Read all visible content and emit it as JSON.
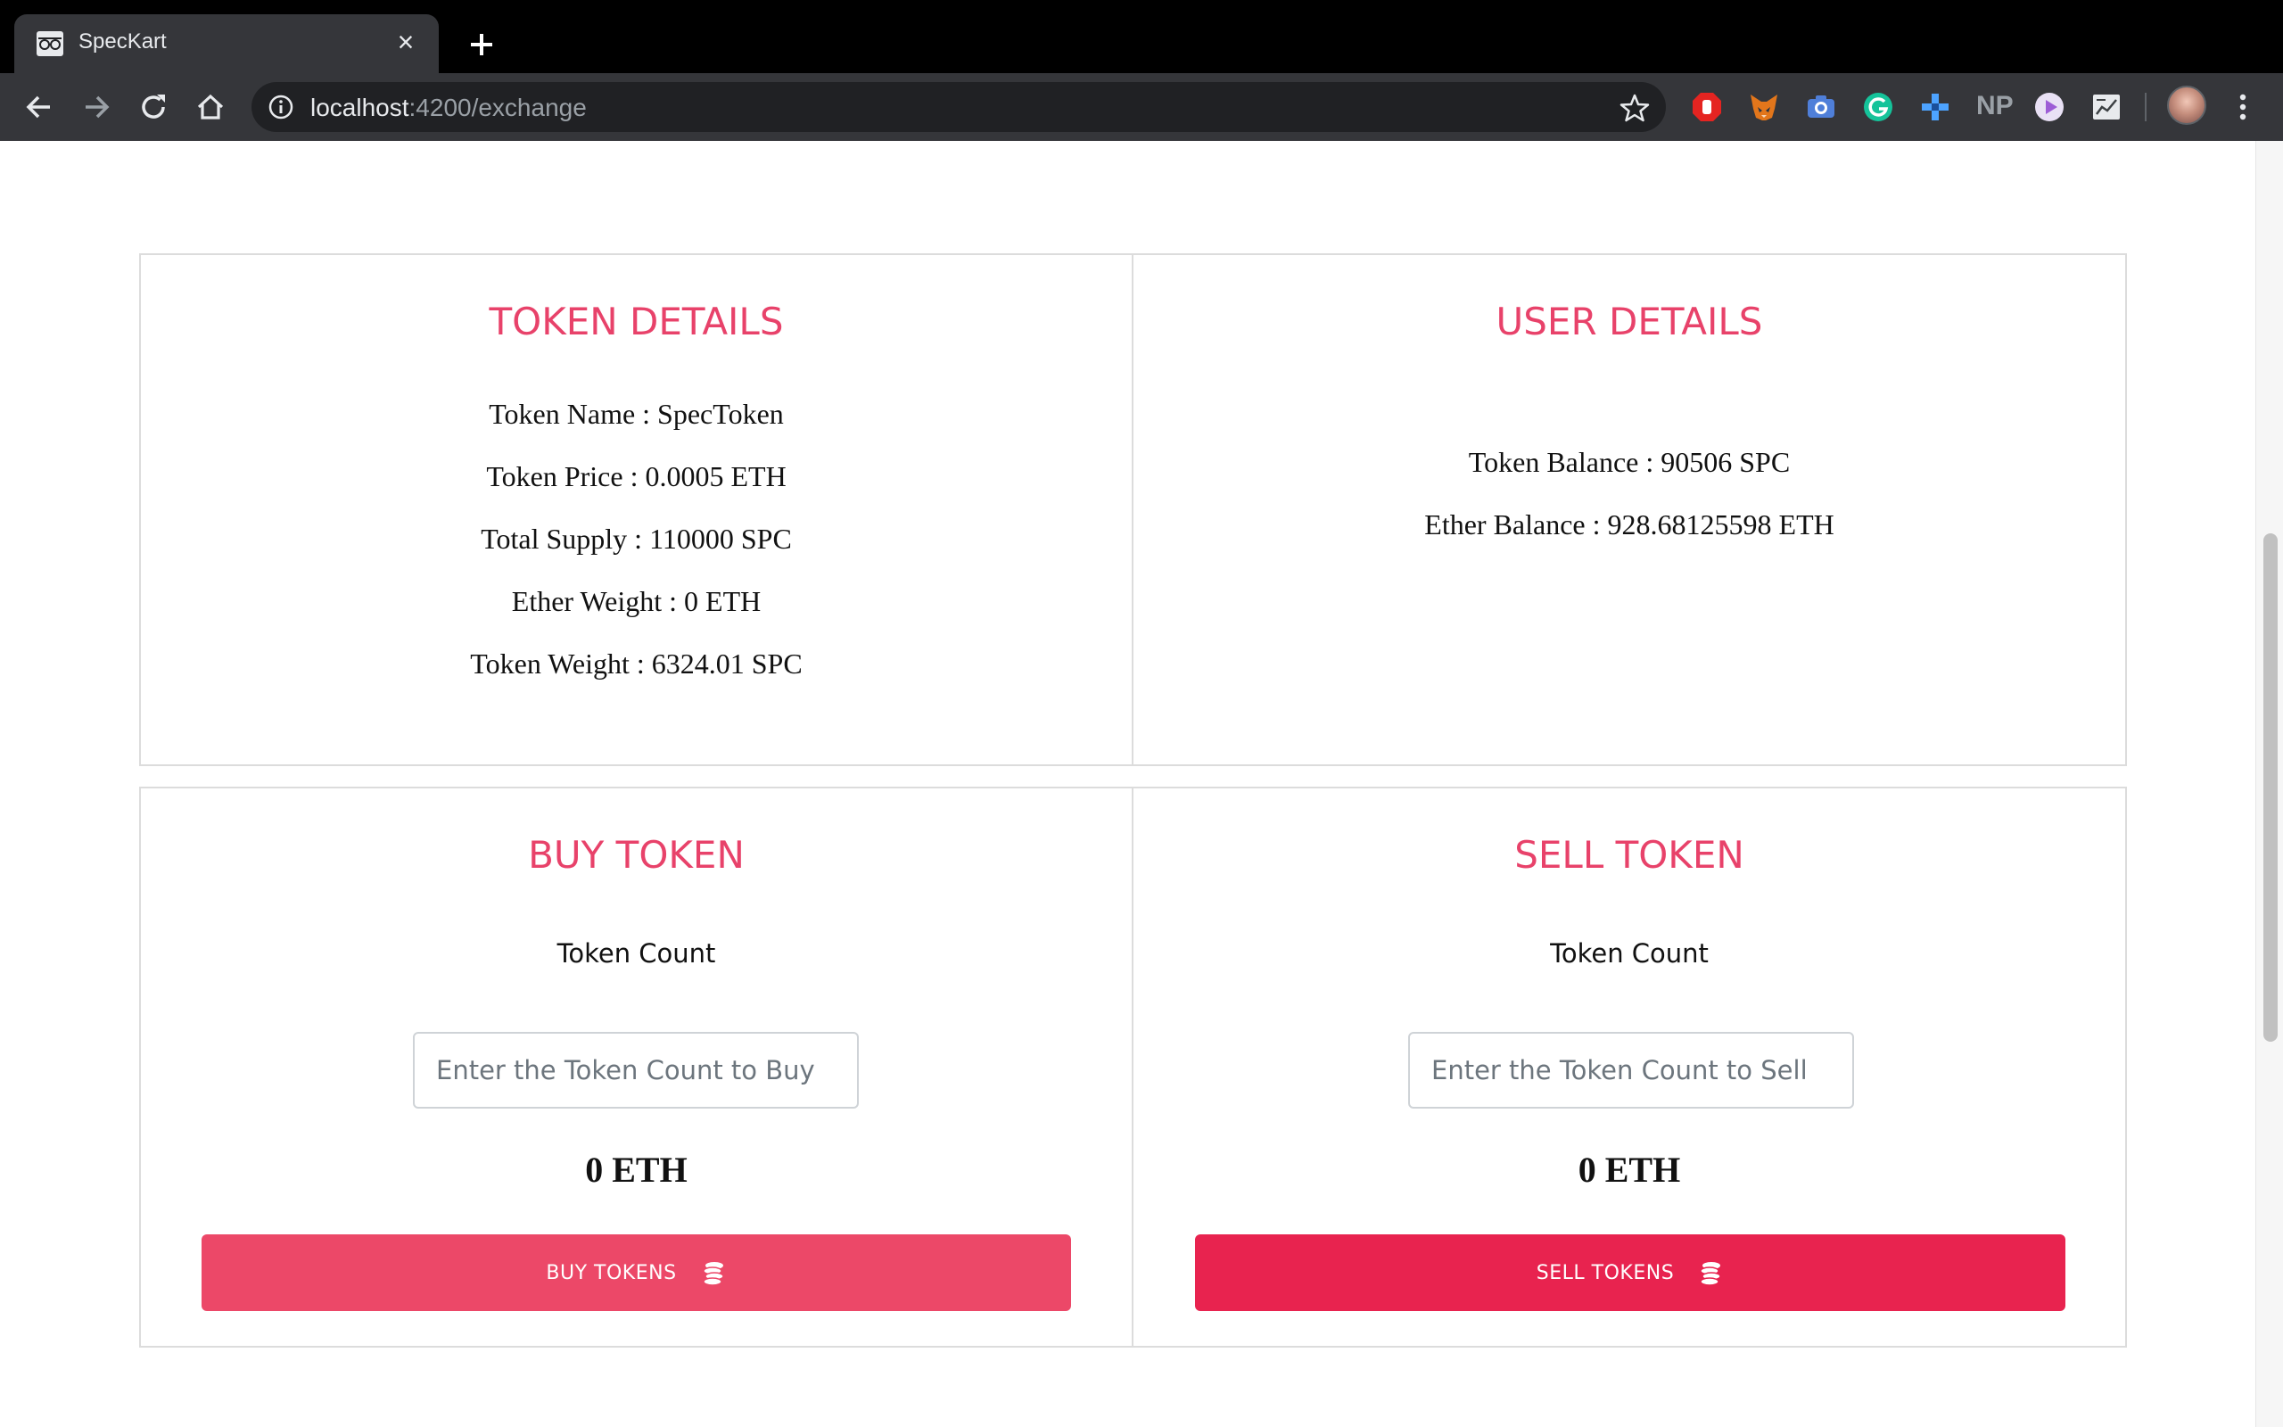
{
  "browser": {
    "tab_title": "SpecKart",
    "url_host": "localhost",
    "url_path": ":4200/exchange",
    "extensions": [
      "stop-extension-icon",
      "metamask-fox-icon",
      "camera-extension-icon",
      "grammarly-icon",
      "plus-cross-extension-icon",
      "np-extension-icon",
      "play-extension-icon",
      "chart-extension-icon"
    ],
    "np_label": "NP"
  },
  "token_details": {
    "title": "TOKEN DETAILS",
    "lines": [
      "Token Name : SpecToken",
      "Token Price : 0.0005 ETH",
      "Total Supply : 110000 SPC",
      "Ether Weight : 0 ETH",
      "Token Weight : 6324.01 SPC"
    ]
  },
  "user_details": {
    "title": "USER DETAILS",
    "lines": [
      "Token Balance : 90506 SPC",
      "Ether Balance : 928.68125598 ETH"
    ]
  },
  "buy": {
    "title": "BUY TOKEN",
    "label": "Token Count",
    "placeholder": "Enter the Token Count to Buy",
    "total": "0 ETH",
    "button_label": "BUY TOKENS",
    "button_color": "#ec4868"
  },
  "sell": {
    "title": "SELL TOKEN",
    "label": "Token Count",
    "placeholder": "Enter the Token Count to Sell",
    "total": "0 ETH",
    "button_label": "SELL TOKENS",
    "button_color": "#e8234f"
  },
  "colors": {
    "accent": "#e8426a",
    "card_border": "#dcdcdc"
  }
}
